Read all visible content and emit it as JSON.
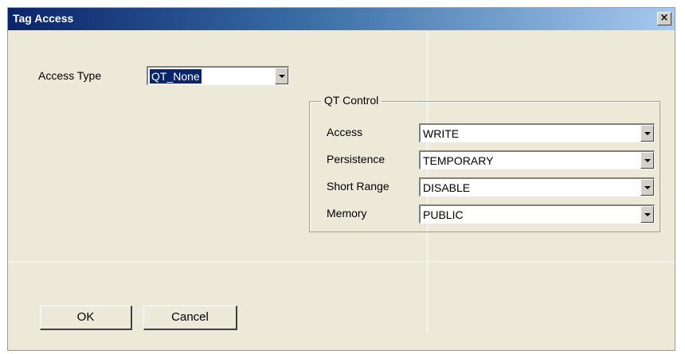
{
  "window": {
    "title": "Tag Access",
    "close_glyph": "×"
  },
  "access_type": {
    "label": "Access Type",
    "value": "QT_None"
  },
  "qt_control": {
    "legend": "QT Control",
    "rows": [
      {
        "label": "Access",
        "value": "WRITE"
      },
      {
        "label": "Persistence",
        "value": "TEMPORARY"
      },
      {
        "label": "Short Range",
        "value": "DISABLE"
      },
      {
        "label": "Memory",
        "value": "PUBLIC"
      }
    ]
  },
  "buttons": {
    "ok": "OK",
    "cancel": "Cancel"
  },
  "colors": {
    "titlebar_start": "#0a246a",
    "titlebar_end": "#a6caf0",
    "dialog_bg": "#ece9d8",
    "selection": "#0a246a"
  },
  "icons": {
    "close": "close-icon",
    "dropdown": "chevron-down-icon"
  }
}
